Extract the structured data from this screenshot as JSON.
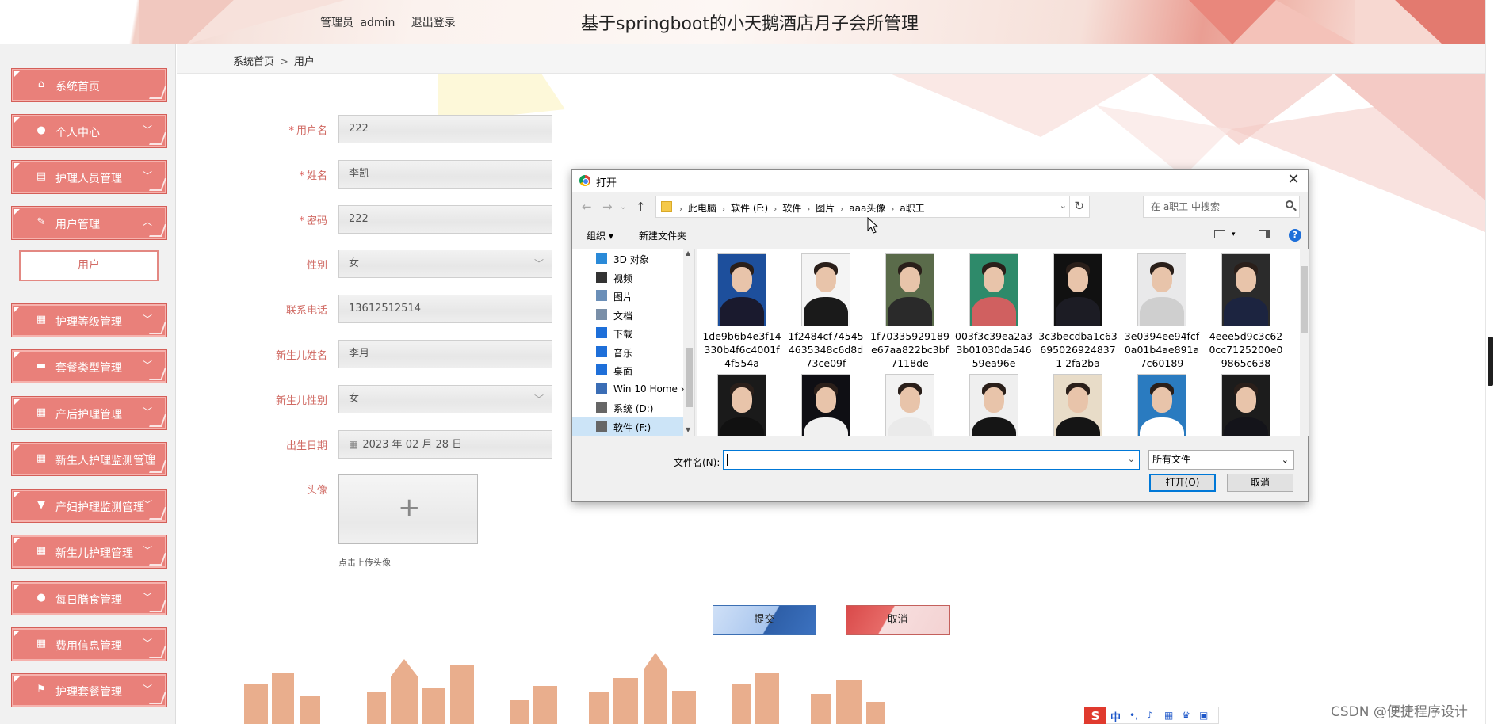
{
  "header": {
    "admin_role": "管理员",
    "admin_name": "admin",
    "logout": "退出登录",
    "title": "基于springboot的小天鹅酒店月子会所管理"
  },
  "sidebar": {
    "items": [
      {
        "label": "系统首页",
        "icon": "home-icon",
        "glyph": "⌂"
      },
      {
        "label": "个人中心",
        "icon": "user-icon",
        "glyph": "●"
      },
      {
        "label": "护理人员管理",
        "icon": "briefcase-icon",
        "glyph": "▤"
      },
      {
        "label": "用户管理",
        "icon": "user-edit-icon",
        "glyph": "✎"
      },
      {
        "label": "护理等级管理",
        "icon": "table-icon",
        "glyph": "▦"
      },
      {
        "label": "套餐类型管理",
        "icon": "ticket-icon",
        "glyph": "▬"
      },
      {
        "label": "产后护理管理",
        "icon": "grid-icon",
        "glyph": "▦"
      },
      {
        "label": "新生人护理监测管理",
        "icon": "grid-icon",
        "glyph": "▦"
      },
      {
        "label": "产妇护理监测管理",
        "icon": "trophy-icon",
        "glyph": "▼"
      },
      {
        "label": "新生儿护理管理",
        "icon": "grid-icon",
        "glyph": "▦"
      },
      {
        "label": "每日膳食管理",
        "icon": "user-icon",
        "glyph": "●"
      },
      {
        "label": "费用信息管理",
        "icon": "grid-icon",
        "glyph": "▦"
      },
      {
        "label": "护理套餐管理",
        "icon": "flag-icon",
        "glyph": "⚑"
      }
    ],
    "submenu_active": "用户",
    "chevron_down": "﹀",
    "chevron_up": "︿"
  },
  "breadcrumb": {
    "home": "系统首页",
    "separator": ">",
    "current": "用户"
  },
  "form": {
    "username_label": "用户名",
    "username_value": "222",
    "name_label": "姓名",
    "name_value": "李凯",
    "password_label": "密码",
    "password_value": "222",
    "gender_label": "性别",
    "gender_value": "女",
    "phone_label": "联系电话",
    "phone_value": "13612512514",
    "baby_name_label": "新生儿姓名",
    "baby_name_value": "李月",
    "baby_gender_label": "新生儿性别",
    "baby_gender_value": "女",
    "birth_label": "出生日期",
    "birth_value": "2023 年 02 月 28 日",
    "avatar_label": "头像",
    "upload_hint": "点击上传头像",
    "required_mark": "*",
    "submit": "提交",
    "cancel": "取消"
  },
  "dialog": {
    "title": "打开",
    "path": [
      "此电脑",
      "软件 (F:)",
      "软件",
      "图片",
      "aaa头像",
      "a职工"
    ],
    "search_placeholder": "在 a职工 中搜索",
    "organize": "组织 ▾",
    "new_folder": "新建文件夹",
    "tree": [
      {
        "label": "3D 对象",
        "color": "#2a8ad8"
      },
      {
        "label": "视频",
        "color": "#333333"
      },
      {
        "label": "图片",
        "color": "#6b8fb8"
      },
      {
        "label": "文档",
        "color": "#7a8fa8"
      },
      {
        "label": "下载",
        "color": "#1e6fd9"
      },
      {
        "label": "音乐",
        "color": "#1e6fd9"
      },
      {
        "label": "桌面",
        "color": "#1e6fd9"
      },
      {
        "label": "Win 10 Home ›",
        "color": "#3a6db5"
      },
      {
        "label": "系统 (D:)",
        "color": "#666666"
      },
      {
        "label": "软件 (F:)",
        "color": "#666666"
      }
    ],
    "files": [
      {
        "name": "1de9b6b4e3f14330b4f6c4001f4f554a",
        "bg": "#1d4f9c",
        "body": "#1a1a2e"
      },
      {
        "name": "1f2484cf745454635348c6d8d73ce09f",
        "bg": "#f4f4f4",
        "body": "#1a1a1a"
      },
      {
        "name": "1f70335929189e67aa822bc3bf7118de",
        "bg": "#5a6b4a",
        "body": "#2a2a2a"
      },
      {
        "name": "003f3c39ea2a33b01030da54659ea96e",
        "bg": "#2e8a6a",
        "body": "#d06060"
      },
      {
        "name": "3c3becdba1c636950269248371 2fa2ba",
        "bg": "#111111",
        "body": "#1c1c24"
      },
      {
        "name": "3e0394ee94fcf0a01b4ae891a7c60189",
        "bg": "#e9e9ea",
        "body": "#cfcfcf"
      },
      {
        "name": "4eee5d9c3c620cc7125200e09865c638",
        "bg": "#2b2b2b",
        "body": "#1c2440"
      },
      {
        "name": "",
        "bg": "#1a1a1a",
        "body": "#111111"
      },
      {
        "name": "",
        "bg": "#0f0f14",
        "body": "#f0f0f0"
      },
      {
        "name": "",
        "bg": "#f2f2f2",
        "body": "#eaeaea"
      },
      {
        "name": "",
        "bg": "#efefef",
        "body": "#151515"
      },
      {
        "name": "",
        "bg": "#e8dcc8",
        "body": "#151515"
      },
      {
        "name": "",
        "bg": "#2a7bc0",
        "body": "#ffffff"
      },
      {
        "name": "",
        "bg": "#1c1c1c",
        "body": "#14141a"
      }
    ],
    "filename_label": "文件名(N):",
    "filename_value": "",
    "filetype": "所有文件",
    "open_button": "打开(O)",
    "cancel_button": "取消"
  },
  "watermark": "CSDN @便捷程序设计",
  "ime": {
    "logo": "S",
    "mode": "中"
  },
  "colors": {
    "menu_red": "#e9807a",
    "label_red": "#d06a63",
    "submit_blue": "#3c72c0",
    "cancel_red": "#d94a4a"
  }
}
